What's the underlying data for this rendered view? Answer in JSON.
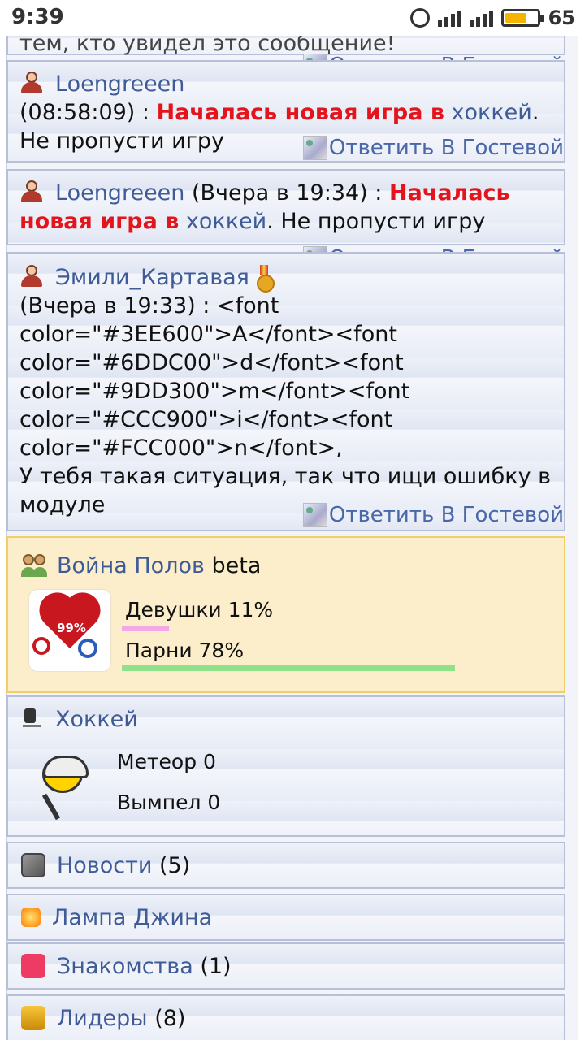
{
  "status_bar": {
    "time": "9:39",
    "battery": "65"
  },
  "posts": [
    {
      "nick": "",
      "time_text": "тем, кто увидел это сообщение!",
      "reply": "Ответить В Гостевой"
    },
    {
      "nick": "Loengreeen",
      "time_text": "(08:58:09) : ",
      "red": "Началась новая игра в",
      "game": "хоккей",
      "tail": ". Не пропусти игру",
      "reply": "Ответить В Гостевой"
    },
    {
      "nick": "Loengreeen",
      "time_text": " (Вчера в 19:34) : ",
      "red": "Началась новая игра в",
      "game": "хоккей",
      "tail": ". Не пропусти игру",
      "reply": "Ответить В Гостевой"
    },
    {
      "nick": "Эмили_Картавая",
      "lines": [
        "(Вчера в 19:33) : <font",
        "color=\"#3EE600\">A</font><font",
        "color=\"#6DDC00\">d</font><font",
        "color=\"#9DD300\">m</font><font",
        "color=\"#CCC900\">i</font><font",
        "color=\"#FCC000\">n</font>,",
        "У тебя такая ситуация, так что ищи ошибку в",
        "модуле"
      ],
      "reply": "Ответить В Гостевой"
    }
  ],
  "war": {
    "title": "Война Полов",
    "badge": "beta",
    "percent_label": "99%",
    "girls": "Девушки 11%",
    "boys": "Парни 78%",
    "girls_pct": 11,
    "boys_pct": 78
  },
  "hockey": {
    "title": "Хоккей",
    "team1": "Метеор 0",
    "team2": "Вымпел 0"
  },
  "menu": [
    {
      "label": "Новости",
      "count": "(5)",
      "icon": "news-icon"
    },
    {
      "label": "Лампа Джина",
      "count": "",
      "icon": "lamp-icon"
    },
    {
      "label": "Знакомства",
      "count": "(1)",
      "icon": "heart-icon"
    },
    {
      "label": "Лидеры",
      "count": "(8)",
      "icon": "trophy-icon"
    }
  ]
}
